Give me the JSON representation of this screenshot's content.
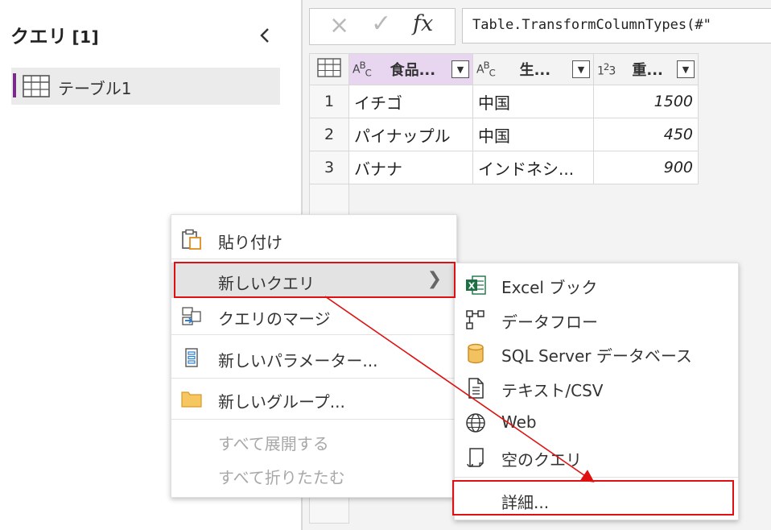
{
  "queries_pane": {
    "title": "クエリ",
    "count": "[1]",
    "items": [
      {
        "label": "テーブル1"
      }
    ]
  },
  "formula_bar": {
    "cancel_icon": "×",
    "commit_icon": "✓",
    "fx_label": "fx",
    "formula": "Table.TransformColumnTypes(#\""
  },
  "table": {
    "columns": [
      {
        "type_label": "AB_C",
        "name": "食品...",
        "type": "text"
      },
      {
        "type_label": "AB_C",
        "name": "生...",
        "type": "text"
      },
      {
        "type_label": "1²3",
        "name": "重...",
        "type": "number"
      }
    ],
    "rows": [
      {
        "n": "1",
        "cells": [
          "イチゴ",
          "中国",
          "1500"
        ]
      },
      {
        "n": "2",
        "cells": [
          "パイナップル",
          "中国",
          "450"
        ]
      },
      {
        "n": "3",
        "cells": [
          "バナナ",
          "インドネシ...",
          "900"
        ]
      }
    ]
  },
  "context_menu": {
    "items": [
      {
        "label": "貼り付け",
        "icon": "paste-icon"
      },
      {
        "label": "新しいクエリ",
        "icon": "none",
        "has_submenu": true
      },
      {
        "label": "クエリのマージ",
        "icon": "merge-queries-icon"
      },
      {
        "label": "新しいパラメーター...",
        "icon": "parameter-icon"
      },
      {
        "label": "新しいグループ...",
        "icon": "folder-icon"
      },
      {
        "label": "すべて展開する",
        "disabled": true
      },
      {
        "label": "すべて折りたたむ",
        "disabled": true
      }
    ]
  },
  "submenu": {
    "items": [
      {
        "label": "Excel ブック",
        "icon": "excel-icon"
      },
      {
        "label": "データフロー",
        "icon": "dataflow-icon"
      },
      {
        "label": "SQL Server データベース",
        "icon": "database-icon"
      },
      {
        "label": "テキスト/CSV",
        "icon": "text-file-icon"
      },
      {
        "label": "Web",
        "icon": "globe-icon"
      },
      {
        "label": "空のクエリ",
        "icon": "blank-query-icon"
      },
      {
        "label": "詳細...",
        "icon": "none"
      }
    ]
  },
  "colors": {
    "accent_purple": "#7a2a8a",
    "highlight_red": "#e01010",
    "excel_green": "#1d7044",
    "database_orange": "#e8a33a",
    "folder_orange": "#f0b440"
  }
}
